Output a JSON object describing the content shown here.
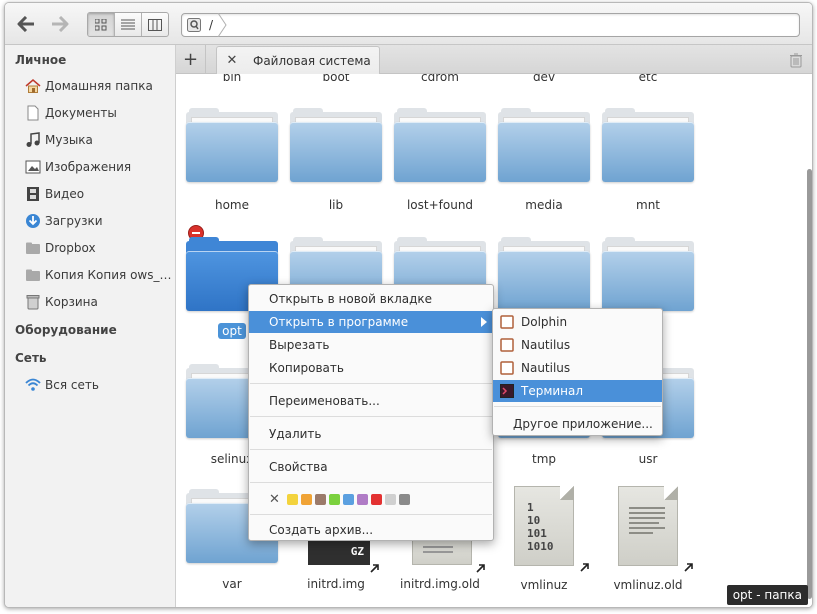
{
  "path": {
    "text": "/"
  },
  "sidebar": {
    "personal_header": "Личное",
    "items": [
      {
        "label": "Домашняя папка",
        "icon": "home-icon"
      },
      {
        "label": "Документы",
        "icon": "document-icon"
      },
      {
        "label": "Музыка",
        "icon": "music-icon"
      },
      {
        "label": "Изображения",
        "icon": "image-icon"
      },
      {
        "label": "Видео",
        "icon": "video-icon"
      },
      {
        "label": "Загрузки",
        "icon": "download-icon"
      },
      {
        "label": "Dropbox",
        "icon": "folder-icon"
      },
      {
        "label": "Копия Копия ows_se...",
        "icon": "folder-icon"
      },
      {
        "label": "Корзина",
        "icon": "trash-icon"
      }
    ],
    "devices_header": "Оборудование",
    "network_header": "Сеть",
    "network_items": [
      {
        "label": "Вся сеть",
        "icon": "network-icon"
      }
    ]
  },
  "tabs": [
    {
      "label": "Файловая система"
    }
  ],
  "files": {
    "row0": [
      "bin",
      "boot",
      "cdrom",
      "dev",
      "etc"
    ],
    "row1": [
      "home",
      "lib",
      "lost+found",
      "media",
      "mnt"
    ],
    "row2": [
      "opt"
    ],
    "row3": [
      "selinux",
      "tmp",
      "usr"
    ],
    "row4": [
      "var",
      "initrd.img",
      "initrd.img.old",
      "vmlinuz",
      "vmlinuz.old"
    ],
    "gz_label": "GZ",
    "binary_text": [
      "1",
      "10",
      "101",
      "1010"
    ]
  },
  "context_menu": {
    "items": [
      "Открыть в новой вкладке",
      "Открыть в программе",
      "Вырезать",
      "Копировать",
      "Переименовать...",
      "Удалить",
      "Свойства",
      "Создать архив..."
    ],
    "color_clear": "✕",
    "colors": [
      "#f3d33d",
      "#f0a335",
      "#9b7a6a",
      "#7bd13e",
      "#5ba0e0",
      "#b07cc6",
      "#e33131",
      "#d0d0d0",
      "#8a8a8a"
    ]
  },
  "submenu": {
    "apps": [
      "Dolphin",
      "Nautilus",
      "Nautilus",
      "Терминал"
    ],
    "other": "Другое приложение..."
  },
  "tooltip": "opt - папка"
}
